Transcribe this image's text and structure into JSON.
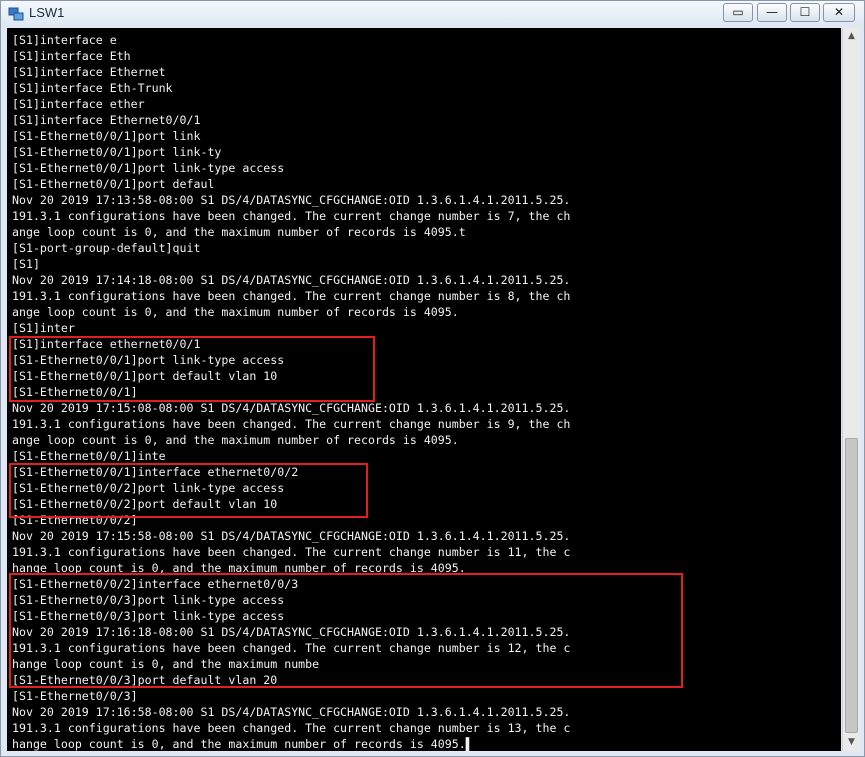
{
  "window": {
    "title": "LSW1",
    "icon": "switch-app-icon",
    "controls": {
      "restore": "▭",
      "minimize": "—",
      "maximize": "☐",
      "close": "✕"
    }
  },
  "terminal": {
    "lines": [
      "[S1]interface e",
      "[S1]interface Eth",
      "[S1]interface Ethernet",
      "[S1]interface Eth-Trunk",
      "[S1]interface ether",
      "[S1]interface Ethernet0/0/1",
      "[S1-Ethernet0/0/1]port link",
      "[S1-Ethernet0/0/1]port link-ty",
      "[S1-Ethernet0/0/1]port link-type access",
      "[S1-Ethernet0/0/1]port defaul",
      "Nov 20 2019 17:13:58-08:00 S1 DS/4/DATASYNC_CFGCHANGE:OID 1.3.6.1.4.1.2011.5.25.",
      "191.3.1 configurations have been changed. The current change number is 7, the ch",
      "ange loop count is 0, and the maximum number of records is 4095.t",
      "[S1-port-group-default]quit",
      "[S1]",
      "Nov 20 2019 17:14:18-08:00 S1 DS/4/DATASYNC_CFGCHANGE:OID 1.3.6.1.4.1.2011.5.25.",
      "191.3.1 configurations have been changed. The current change number is 8, the ch",
      "ange loop count is 0, and the maximum number of records is 4095.",
      "[S1]inter",
      "[S1]interface ethernet0/0/1",
      "[S1-Ethernet0/0/1]port link-type access",
      "[S1-Ethernet0/0/1]port default vlan 10",
      "[S1-Ethernet0/0/1]",
      "Nov 20 2019 17:15:08-08:00 S1 DS/4/DATASYNC_CFGCHANGE:OID 1.3.6.1.4.1.2011.5.25.",
      "191.3.1 configurations have been changed. The current change number is 9, the ch",
      "ange loop count is 0, and the maximum number of records is 4095.",
      "[S1-Ethernet0/0/1]inte",
      "[S1-Ethernet0/0/1]interface ethernet0/0/2",
      "[S1-Ethernet0/0/2]port link-type access",
      "[S1-Ethernet0/0/2]port default vlan 10",
      "[S1-Ethernet0/0/2]",
      "Nov 20 2019 17:15:58-08:00 S1 DS/4/DATASYNC_CFGCHANGE:OID 1.3.6.1.4.1.2011.5.25.",
      "191.3.1 configurations have been changed. The current change number is 11, the c",
      "hange loop count is 0, and the maximum number of records is 4095.",
      "[S1-Ethernet0/0/2]interface ethernet0/0/3",
      "[S1-Ethernet0/0/3]port link-type access",
      "[S1-Ethernet0/0/3]port link-type access",
      "Nov 20 2019 17:16:18-08:00 S1 DS/4/DATASYNC_CFGCHANGE:OID 1.3.6.1.4.1.2011.5.25.",
      "191.3.1 configurations have been changed. The current change number is 12, the c",
      "hange loop count is 0, and the maximum numbe",
      "[S1-Ethernet0/0/3]port default vlan 20",
      "[S1-Ethernet0/0/3]",
      "Nov 20 2019 17:16:58-08:00 S1 DS/4/DATASYNC_CFGCHANGE:OID 1.3.6.1.4.1.2011.5.25.",
      "191.3.1 configurations have been changed. The current change number is 13, the c",
      "hange loop count is 0, and the maximum number of records is 4095."
    ],
    "cursor": "▌"
  },
  "colors": {
    "highlight": "#e02020",
    "terminal_bg": "#000000",
    "terminal_text": "#f2f2f2"
  },
  "scrollbar": {
    "up": "▲",
    "down": "▼"
  }
}
